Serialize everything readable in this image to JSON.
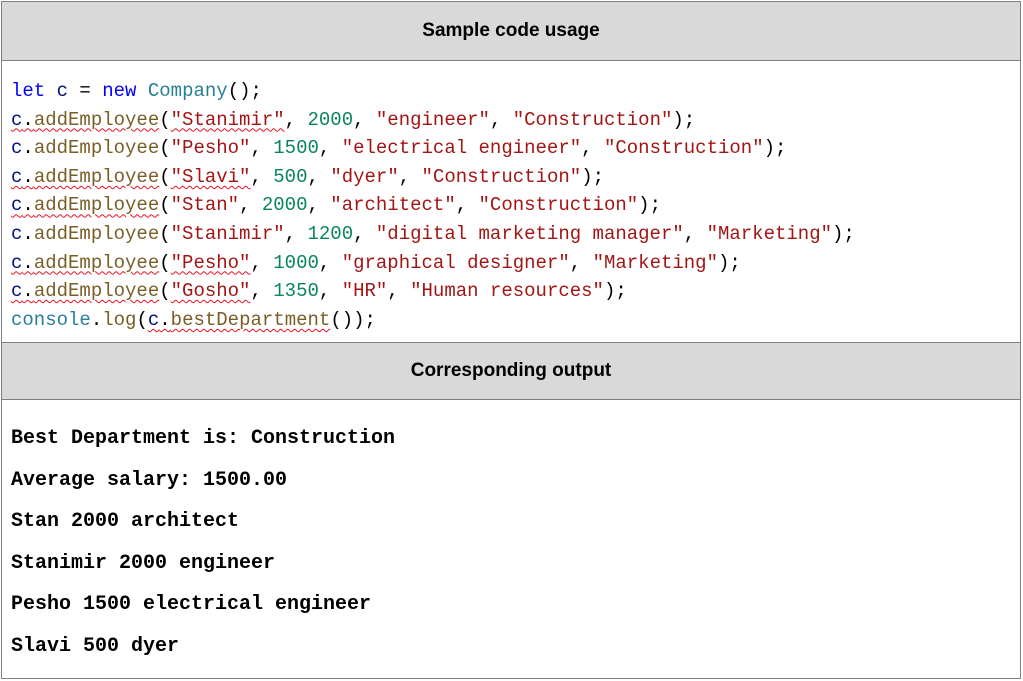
{
  "sections": {
    "code_header": "Sample code usage",
    "output_header": "Corresponding output"
  },
  "code_lines": [
    {
      "tokens": [
        {
          "t": "let",
          "c": "kw"
        },
        {
          "t": " ",
          "c": "pl"
        },
        {
          "t": "c",
          "c": "var"
        },
        {
          "t": " = ",
          "c": "pl"
        },
        {
          "t": "new",
          "c": "kw"
        },
        {
          "t": " ",
          "c": "pl"
        },
        {
          "t": "Company",
          "c": "cls"
        },
        {
          "t": "();",
          "c": "pl"
        }
      ]
    },
    {
      "tokens": [
        {
          "t": "c",
          "c": "var",
          "sq": true
        },
        {
          "t": ".",
          "c": "pl",
          "sq": true
        },
        {
          "t": "addEmployee",
          "c": "fn",
          "sq": true
        },
        {
          "t": "(",
          "c": "pl"
        },
        {
          "t": "\"Stanimir\"",
          "c": "str",
          "sq": true
        },
        {
          "t": ", ",
          "c": "pl"
        },
        {
          "t": "2000",
          "c": "num"
        },
        {
          "t": ", ",
          "c": "pl"
        },
        {
          "t": "\"engineer\"",
          "c": "str"
        },
        {
          "t": ", ",
          "c": "pl"
        },
        {
          "t": "\"Construction\"",
          "c": "str"
        },
        {
          "t": ");",
          "c": "pl"
        }
      ]
    },
    {
      "tokens": [
        {
          "t": "c",
          "c": "var"
        },
        {
          "t": ".",
          "c": "pl"
        },
        {
          "t": "addEmployee",
          "c": "fn"
        },
        {
          "t": "(",
          "c": "pl"
        },
        {
          "t": "\"Pesho\"",
          "c": "str"
        },
        {
          "t": ", ",
          "c": "pl"
        },
        {
          "t": "1500",
          "c": "num"
        },
        {
          "t": ", ",
          "c": "pl"
        },
        {
          "t": "\"electrical engineer\"",
          "c": "str"
        },
        {
          "t": ", ",
          "c": "pl"
        },
        {
          "t": "\"Construction\"",
          "c": "str"
        },
        {
          "t": ");",
          "c": "pl"
        }
      ]
    },
    {
      "tokens": [
        {
          "t": "c",
          "c": "var",
          "sq": true
        },
        {
          "t": ".",
          "c": "pl",
          "sq": true
        },
        {
          "t": "addEmployee",
          "c": "fn",
          "sq": true
        },
        {
          "t": "(",
          "c": "pl"
        },
        {
          "t": "\"Slavi\"",
          "c": "str",
          "sq": true
        },
        {
          "t": ", ",
          "c": "pl"
        },
        {
          "t": "500",
          "c": "num"
        },
        {
          "t": ", ",
          "c": "pl"
        },
        {
          "t": "\"dyer\"",
          "c": "str"
        },
        {
          "t": ", ",
          "c": "pl"
        },
        {
          "t": "\"Construction\"",
          "c": "str"
        },
        {
          "t": ");",
          "c": "pl"
        }
      ]
    },
    {
      "tokens": [
        {
          "t": "c",
          "c": "var",
          "sq": true
        },
        {
          "t": ".",
          "c": "pl",
          "sq": true
        },
        {
          "t": "addEmployee",
          "c": "fn",
          "sq": true
        },
        {
          "t": "(",
          "c": "pl"
        },
        {
          "t": "\"Stan\"",
          "c": "str"
        },
        {
          "t": ", ",
          "c": "pl"
        },
        {
          "t": "2000",
          "c": "num"
        },
        {
          "t": ", ",
          "c": "pl"
        },
        {
          "t": "\"architect\"",
          "c": "str"
        },
        {
          "t": ", ",
          "c": "pl"
        },
        {
          "t": "\"Construction\"",
          "c": "str"
        },
        {
          "t": ");",
          "c": "pl"
        }
      ]
    },
    {
      "tokens": [
        {
          "t": "c",
          "c": "var"
        },
        {
          "t": ".",
          "c": "pl"
        },
        {
          "t": "addEmployee",
          "c": "fn"
        },
        {
          "t": "(",
          "c": "pl"
        },
        {
          "t": "\"Stanimir\"",
          "c": "str"
        },
        {
          "t": ", ",
          "c": "pl"
        },
        {
          "t": "1200",
          "c": "num"
        },
        {
          "t": ", ",
          "c": "pl"
        },
        {
          "t": "\"digital marketing manager\"",
          "c": "str"
        },
        {
          "t": ", ",
          "c": "pl"
        },
        {
          "t": "\"Marketing\"",
          "c": "str"
        },
        {
          "t": ");",
          "c": "pl"
        }
      ]
    },
    {
      "tokens": [
        {
          "t": "c",
          "c": "var",
          "sq": true
        },
        {
          "t": ".",
          "c": "pl",
          "sq": true
        },
        {
          "t": "addEmployee",
          "c": "fn",
          "sq": true
        },
        {
          "t": "(",
          "c": "pl"
        },
        {
          "t": "\"Pesho\"",
          "c": "str",
          "sq": true
        },
        {
          "t": ", ",
          "c": "pl"
        },
        {
          "t": "1000",
          "c": "num"
        },
        {
          "t": ", ",
          "c": "pl"
        },
        {
          "t": "\"graphical designer\"",
          "c": "str"
        },
        {
          "t": ", ",
          "c": "pl"
        },
        {
          "t": "\"Marketing\"",
          "c": "str"
        },
        {
          "t": ");",
          "c": "pl"
        }
      ]
    },
    {
      "tokens": [
        {
          "t": "c",
          "c": "var",
          "sq": true
        },
        {
          "t": ".",
          "c": "pl",
          "sq": true
        },
        {
          "t": "addEmployee",
          "c": "fn",
          "sq": true
        },
        {
          "t": "(",
          "c": "pl"
        },
        {
          "t": "\"Gosho\"",
          "c": "str",
          "sq": true
        },
        {
          "t": ", ",
          "c": "pl"
        },
        {
          "t": "1350",
          "c": "num"
        },
        {
          "t": ", ",
          "c": "pl"
        },
        {
          "t": "\"HR\"",
          "c": "str"
        },
        {
          "t": ", ",
          "c": "pl"
        },
        {
          "t": "\"Human resources\"",
          "c": "str"
        },
        {
          "t": ");",
          "c": "pl"
        }
      ]
    },
    {
      "tokens": [
        {
          "t": "console",
          "c": "cls"
        },
        {
          "t": ".",
          "c": "pl"
        },
        {
          "t": "log",
          "c": "fn"
        },
        {
          "t": "(",
          "c": "pl"
        },
        {
          "t": "c",
          "c": "var",
          "sq": true
        },
        {
          "t": ".",
          "c": "pl",
          "sq": true
        },
        {
          "t": "bestDepartment",
          "c": "fn",
          "sq": true
        },
        {
          "t": "());",
          "c": "pl"
        }
      ]
    }
  ],
  "output_lines": [
    "Best Department is: Construction",
    "Average salary: 1500.00",
    "Stan 2000 architect",
    "Stanimir 2000 engineer",
    "Pesho 1500 electrical engineer",
    "Slavi 500 dyer"
  ],
  "colors": {
    "header_bg": "#d9d9d9",
    "border": "#7f7f7f",
    "keyword": "#0000ff",
    "variable": "#001080",
    "class": "#267f99",
    "function": "#795e26",
    "string": "#a31515",
    "number": "#098658",
    "spellcheck_squiggle": "#e81123"
  }
}
